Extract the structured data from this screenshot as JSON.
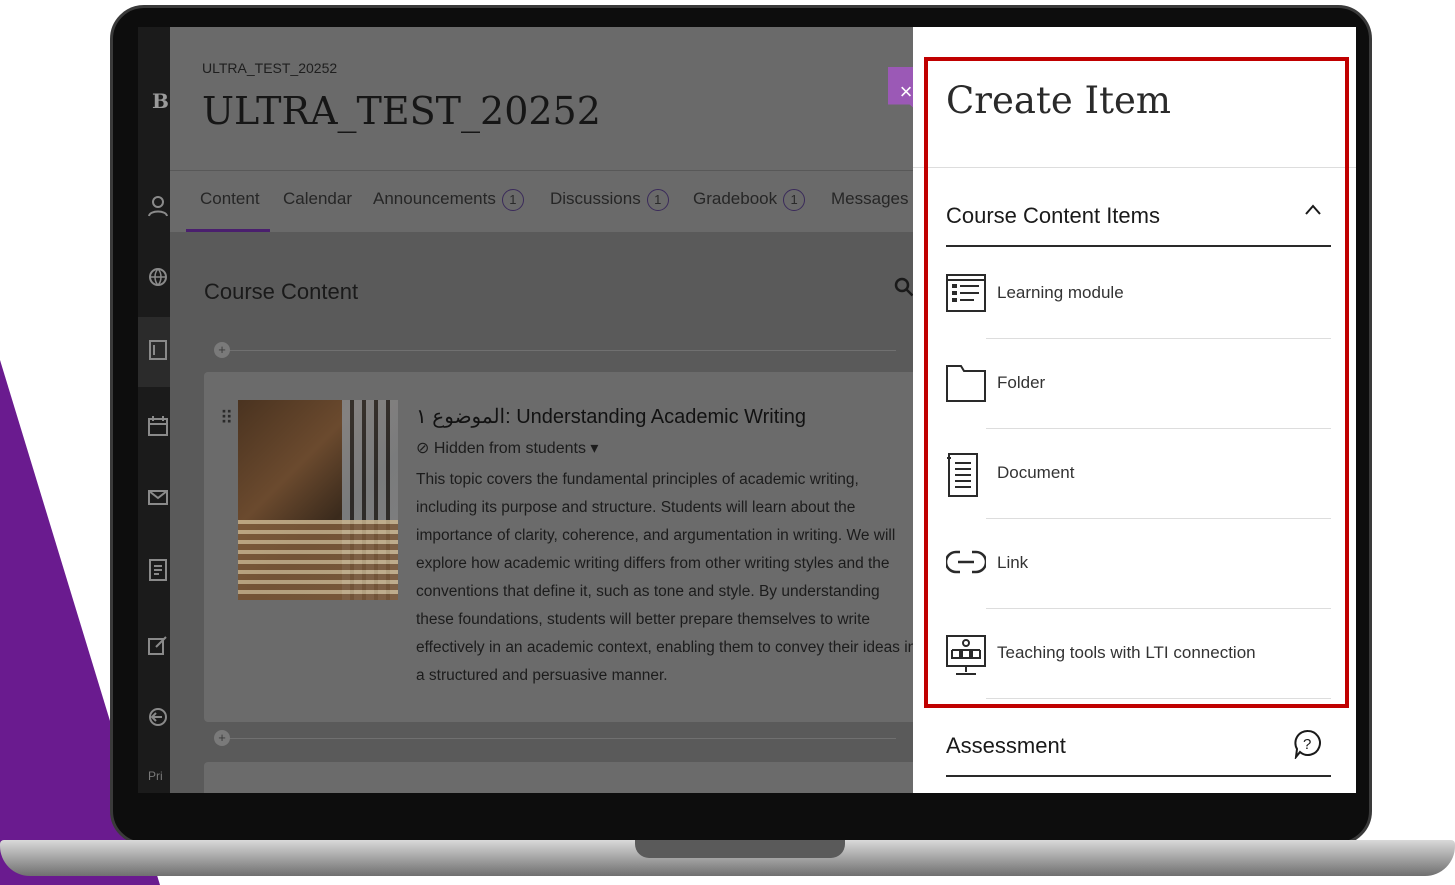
{
  "course": {
    "code": "ULTRA_TEST_20252",
    "title": "ULTRA_TEST_20252"
  },
  "nav": {
    "brand_letter": "B",
    "footer_text": "Pri"
  },
  "tabs": [
    {
      "label": "Content",
      "badge": ""
    },
    {
      "label": "Calendar",
      "badge": ""
    },
    {
      "label": "Announcements",
      "badge": "1"
    },
    {
      "label": "Discussions",
      "badge": "1"
    },
    {
      "label": "Gradebook",
      "badge": "1"
    },
    {
      "label": "Messages",
      "badge": "("
    }
  ],
  "course_content": {
    "heading": "Course Content",
    "item": {
      "title": "الموضوع ١: Understanding Academic Writing",
      "status": "Hidden from students",
      "description": "This topic covers the fundamental principles of academic writing, including its purpose and structure. Students will learn about the importance of clarity, coherence, and argumentation in writing. We will explore how academic writing differs from other writing styles and the conventions that define it, such as tone and style. By understanding these foundations, students will better prepare themselves to write effectively in an academic context, enabling them to convey their ideas in a structured and persuasive manner."
    }
  },
  "panel": {
    "title": "Create Item",
    "close": "×",
    "groups": [
      {
        "label": "Course Content Items",
        "icon": "chevron-up-icon"
      },
      {
        "label": "Assessment",
        "icon": "help-bubble-icon"
      }
    ],
    "items": [
      {
        "label": "Learning module",
        "icon": "learning-module-icon"
      },
      {
        "label": "Folder",
        "icon": "folder-icon"
      },
      {
        "label": "Document",
        "icon": "document-icon"
      },
      {
        "label": "Link",
        "icon": "link-icon"
      },
      {
        "label": "Teaching tools with LTI connection",
        "icon": "lti-tools-icon"
      }
    ]
  },
  "colors": {
    "accent_purple": "#9b59b6",
    "highlight_red": "#c00000",
    "tab_underline": "#4a1f6e"
  }
}
